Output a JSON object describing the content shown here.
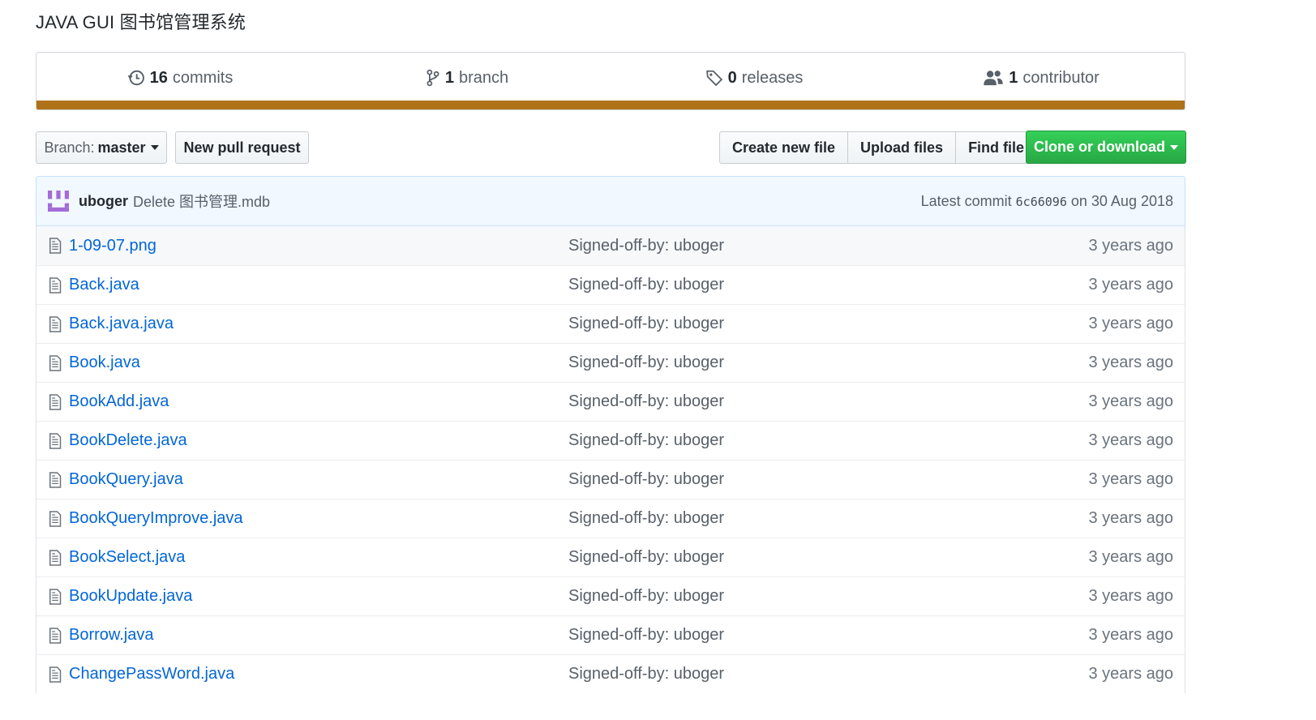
{
  "repo": {
    "description": "JAVA GUI 图书馆管理系统"
  },
  "summary": {
    "commits": {
      "count": "16",
      "label": "commits"
    },
    "branches": {
      "count": "1",
      "label": "branch"
    },
    "releases": {
      "count": "0",
      "label": "releases"
    },
    "contributors": {
      "count": "1",
      "label": "contributor"
    },
    "language_color": "#b07219"
  },
  "toolbar": {
    "branch_label": "Branch:",
    "branch_value": "master",
    "new_pr": "New pull request",
    "create_file": "Create new file",
    "upload_files": "Upload files",
    "find_file": "Find file",
    "clone": "Clone or download"
  },
  "commit": {
    "author": "uboger",
    "message": "Delete 图书管理.mdb",
    "latest_prefix": "Latest commit",
    "sha": "6c66096",
    "date": "on 30 Aug 2018"
  },
  "files": [
    {
      "name": "1-09-07.png",
      "message": "Signed-off-by: uboger",
      "age": "3 years ago"
    },
    {
      "name": "Back.java",
      "message": "Signed-off-by: uboger",
      "age": "3 years ago"
    },
    {
      "name": "Back.java.java",
      "message": "Signed-off-by: uboger",
      "age": "3 years ago"
    },
    {
      "name": "Book.java",
      "message": "Signed-off-by: uboger",
      "age": "3 years ago"
    },
    {
      "name": "BookAdd.java",
      "message": "Signed-off-by: uboger",
      "age": "3 years ago"
    },
    {
      "name": "BookDelete.java",
      "message": "Signed-off-by: uboger",
      "age": "3 years ago"
    },
    {
      "name": "BookQuery.java",
      "message": "Signed-off-by: uboger",
      "age": "3 years ago"
    },
    {
      "name": "BookQueryImprove.java",
      "message": "Signed-off-by: uboger",
      "age": "3 years ago"
    },
    {
      "name": "BookSelect.java",
      "message": "Signed-off-by: uboger",
      "age": "3 years ago"
    },
    {
      "name": "BookUpdate.java",
      "message": "Signed-off-by: uboger",
      "age": "3 years ago"
    },
    {
      "name": "Borrow.java",
      "message": "Signed-off-by: uboger",
      "age": "3 years ago"
    },
    {
      "name": "ChangePassWord.java",
      "message": "Signed-off-by: uboger",
      "age": "3 years ago"
    }
  ]
}
